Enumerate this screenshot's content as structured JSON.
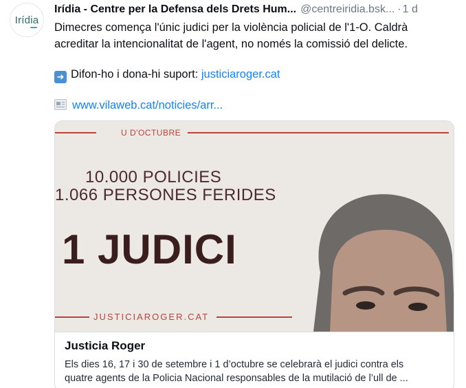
{
  "post": {
    "avatar_text": "Irídia",
    "author": "Irídia - Centre per la Defensa dels Drets Hum...",
    "handle": "@centreiridia.bsk...",
    "separator": "·",
    "time": "1 d",
    "text_line1": "Dimecres comença l'únic judici per la violència policial de l'1-O. Caldrà",
    "text_line2": "acreditar la intencionalitat de l'agent, no només la comissió del delicte.",
    "share_icon": "right-arrow-emoji",
    "share_text": "Difon-ho i dona-hi suport: ",
    "share_link": "justiciaroger.cat",
    "link_icon": "newspaper-emoji",
    "link_url": "www.vilaweb.cat/noticies/arr..."
  },
  "card": {
    "image": {
      "caption": "U D'OCTUBRE",
      "line1": "10.000 POLICIES",
      "line2": "1.066 PERSONES FERIDES",
      "headline": "1 JUDICI",
      "footer": "JUSTICIAROGER.CAT",
      "accent_color": "#b8423a"
    },
    "title": "Justicia Roger",
    "description_line1": "Els dies 16, 17 i 30 de setembre i 1 d’octubre se celebrarà el judici contra els",
    "description_line2": "quatre agents de la Policia Nacional responsables de la mutilació de l’ull de ..."
  },
  "colors": {
    "link": "#1083fe",
    "muted": "#6b7785",
    "border": "#d9dee3"
  }
}
